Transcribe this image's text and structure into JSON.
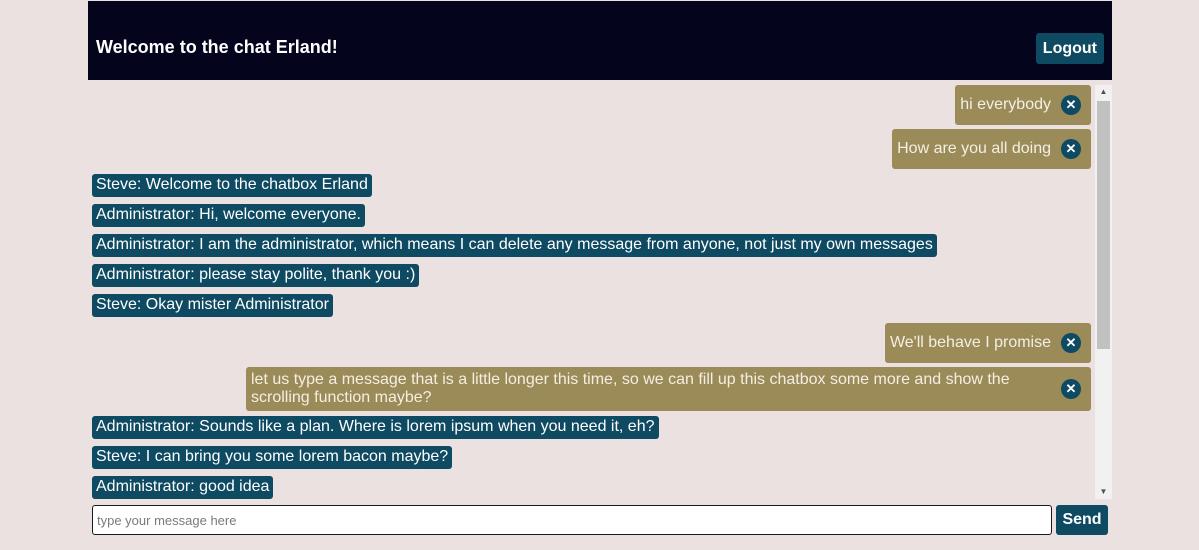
{
  "header": {
    "title": "Welcome to the chat Erland!",
    "logout_label": "Logout"
  },
  "messages": [
    {
      "own": true,
      "text": "hi everybody",
      "delete_icon": "close-icon"
    },
    {
      "own": true,
      "text": "How are you all doing",
      "delete_icon": "close-icon"
    },
    {
      "own": false,
      "text": "Steve: Welcome to the chatbox Erland"
    },
    {
      "own": false,
      "text": "Administrator: Hi, welcome everyone."
    },
    {
      "own": false,
      "text": "Administrator: I am the administrator, which means I can delete any message from anyone, not just my own messages"
    },
    {
      "own": false,
      "text": "Administrator: please stay polite, thank you :)"
    },
    {
      "own": false,
      "text": "Steve: Okay mister Administrator"
    },
    {
      "own": true,
      "text": "We'll behave I promise",
      "delete_icon": "close-icon"
    },
    {
      "own": true,
      "text": "let us type a message that is a little longer this time, so we can fill up this chatbox some more and show the scrolling function maybe?",
      "delete_icon": "close-icon"
    },
    {
      "own": false,
      "text": "Administrator: Sounds like a plan. Where is lorem ipsum when you need it, eh?"
    },
    {
      "own": false,
      "text": "Steve: I can bring you some lorem bacon maybe?"
    },
    {
      "own": false,
      "text": "Administrator: good idea"
    }
  ],
  "composer": {
    "placeholder": "type your message here",
    "value": "",
    "send_label": "Send"
  },
  "colors": {
    "header_bg": "#04041c",
    "accent": "#0e4a62",
    "own_message": "#9a8b59",
    "page_bg": "#ebe1e1"
  }
}
